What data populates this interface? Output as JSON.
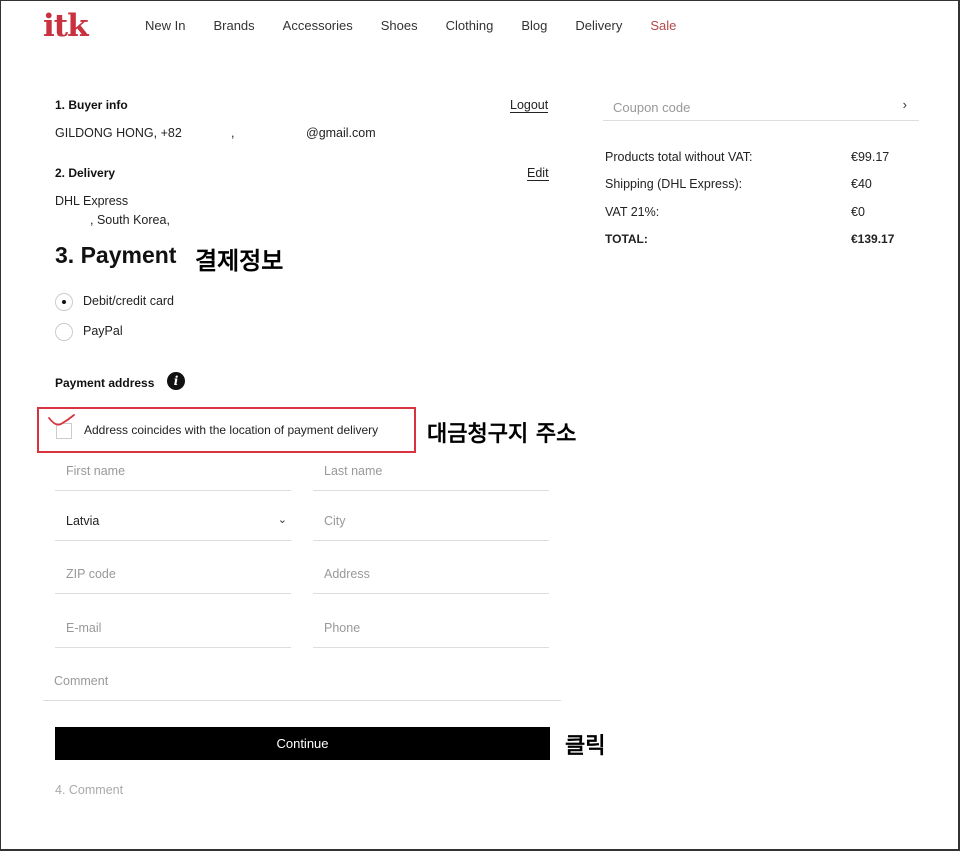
{
  "header": {
    "logo": "itk",
    "nav": [
      "New In",
      "Brands",
      "Accessories",
      "Shoes",
      "Clothing",
      "Blog",
      "Delivery"
    ],
    "sale": "Sale"
  },
  "buyer": {
    "title": "1. Buyer info",
    "logout": "Logout",
    "name_phone": "GILDONG HONG, +82",
    "comma": ",",
    "email": "@gmail.com"
  },
  "delivery": {
    "title": "2. Delivery",
    "edit": "Edit",
    "carrier": "DHL Express",
    "address": ", South Korea,"
  },
  "payment": {
    "title": "3. Payment",
    "annotation": "결제정보",
    "options": [
      "Debit/credit card",
      "PayPal"
    ],
    "selected": "Debit/credit card",
    "address_label": "Payment address",
    "info_icon": "info-icon",
    "coincides": "Address coincides with the location of payment delivery",
    "coincides_annotation": "대금청구지 주소",
    "first_name_ph": "First name",
    "last_name_ph": "Last name",
    "country": "Latvia",
    "city_ph": "City",
    "zip_ph": "ZIP code",
    "address_ph": "Address",
    "email_ph": "E-mail",
    "phone_ph": "Phone",
    "comment_ph": "Comment",
    "continue": "Continue",
    "click_annotation": "클릭"
  },
  "comment_step": "4. Comment",
  "summary": {
    "coupon_ph": "Coupon code",
    "rows": [
      {
        "label": "Products total without VAT:",
        "value": "€99.17"
      },
      {
        "label": "Shipping (DHL Express):",
        "value": "€40"
      },
      {
        "label": "VAT 21%:",
        "value": "€0"
      },
      {
        "label": "TOTAL:",
        "value": "€139.17"
      }
    ]
  },
  "colors": {
    "brand": "#c8313d",
    "highlight": "#d9333f",
    "button": "#000000"
  }
}
